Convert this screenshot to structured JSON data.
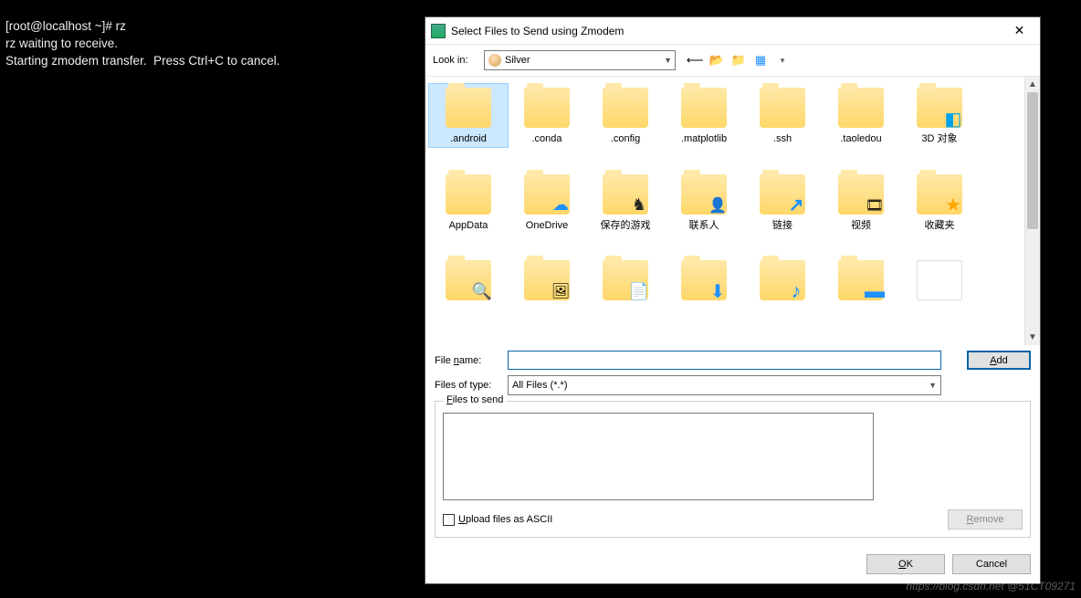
{
  "terminal": {
    "line0": "[root@localhost ~]# rz",
    "line1": "rz waiting to receive.",
    "line2": "Starting zmodem transfer.  Press Ctrl+C to cancel."
  },
  "dialog": {
    "title": "Select Files to Send using Zmodem",
    "lookin_label": "Look in:",
    "lookin_value": "Silver",
    "files": {
      "r0": [
        {
          "name": ".android",
          "icon": "folder",
          "overlay": ""
        },
        {
          "name": ".conda",
          "icon": "folder",
          "overlay": ""
        },
        {
          "name": ".config",
          "icon": "folder",
          "overlay": ""
        },
        {
          "name": ".matplotlib",
          "icon": "folder",
          "overlay": ""
        },
        {
          "name": ".ssh",
          "icon": "folder",
          "overlay": ""
        },
        {
          "name": ".taoledou",
          "icon": "folder",
          "overlay": ""
        },
        {
          "name": "3D 对象",
          "icon": "folder",
          "overlay": "ov-3d"
        }
      ],
      "r1": [
        {
          "name": "AppData",
          "icon": "folder",
          "overlay": ""
        },
        {
          "name": "OneDrive",
          "icon": "folder",
          "overlay": "ov-cloud"
        },
        {
          "name": "保存的游戏",
          "icon": "folder",
          "overlay": "ov-chess"
        },
        {
          "name": "联系人",
          "icon": "folder",
          "overlay": "ov-person"
        },
        {
          "name": "链接",
          "icon": "folder",
          "overlay": "ov-linkar"
        },
        {
          "name": "视频",
          "icon": "folder",
          "overlay": "ov-film"
        },
        {
          "name": "收藏夹",
          "icon": "folder",
          "overlay": "ov-star"
        }
      ],
      "r2": [
        {
          "name": "",
          "icon": "folder",
          "overlay": "ov-lens"
        },
        {
          "name": "",
          "icon": "folder",
          "overlay": "ov-pic"
        },
        {
          "name": "",
          "icon": "folder",
          "overlay": "ov-doc"
        },
        {
          "name": "",
          "icon": "folder",
          "overlay": "ov-down"
        },
        {
          "name": "",
          "icon": "folder",
          "overlay": "ov-note"
        },
        {
          "name": "",
          "icon": "folder",
          "overlay": "ov-desk"
        },
        {
          "name": "",
          "icon": "file",
          "overlay": ""
        }
      ]
    },
    "filename_label": "File name:",
    "filename_value": "",
    "filetype_label": "Files of type:",
    "filetype_value": "All Files (*.*)",
    "add_label": "Add",
    "fieldset_legend": "Files to send",
    "ascii_label": "Upload files as ASCII",
    "remove_label": "Remove",
    "ok_label": "OK",
    "cancel_label": "Cancel"
  },
  "watermark": "https://blog.csdn.net  @51CT09271"
}
